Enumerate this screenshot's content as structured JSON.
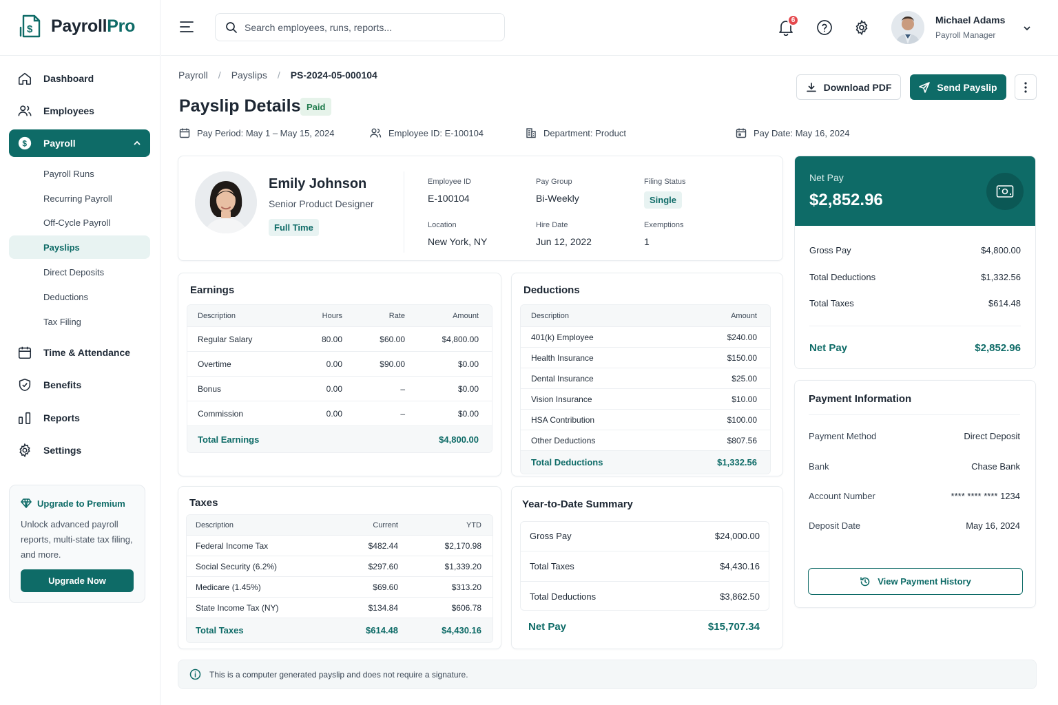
{
  "brand": {
    "name": "Payroll",
    "name_accent": "Pro"
  },
  "sidebar": {
    "nav": [
      {
        "label": "Dashboard",
        "icon": "home-icon"
      },
      {
        "label": "Employees",
        "icon": "users-icon"
      },
      {
        "label": "Payroll",
        "icon": "dollar-icon",
        "active": true
      },
      {
        "label": "Time & Attendance",
        "icon": "calendar-icon"
      },
      {
        "label": "Benefits",
        "icon": "shield-icon"
      },
      {
        "label": "Reports",
        "icon": "bar-chart-icon"
      },
      {
        "label": "Settings",
        "icon": "gear-icon"
      }
    ],
    "payroll_sub": [
      "Payroll Runs",
      "Recurring Payroll",
      "Off-Cycle Payroll",
      "Payslips",
      "Direct Deposits",
      "Deductions",
      "Tax Filing"
    ],
    "active_sub": "Payslips",
    "premium": {
      "title": "Upgrade to Premium",
      "text": "Unlock advanced payroll reports, multi-state tax filing, and more.",
      "button": "Upgrade Now"
    }
  },
  "topbar": {
    "search_placeholder": "Search employees, runs, reports...",
    "notification_count": "6",
    "user": {
      "name": "Michael Adams",
      "role": "Payroll Manager"
    }
  },
  "breadcrumb": [
    "Payroll",
    "Payslips",
    "PS-2024-05-000104"
  ],
  "page": {
    "title": "Payslip Details",
    "status": "Paid",
    "actions": {
      "download": "Download PDF",
      "send": "Send Payslip"
    },
    "meta": {
      "pay_period": "Pay Period: May 1 – May 15, 2024",
      "employee_id": "Employee ID: E-100104",
      "department": "Department: Product",
      "pay_date": "Pay Date: May 16, 2024"
    }
  },
  "employee": {
    "name": "Emily Johnson",
    "title": "Senior Product Designer",
    "type": "Full Time",
    "fields": {
      "employee_id_label": "Employee ID",
      "employee_id": "E-100104",
      "pay_group_label": "Pay Group",
      "pay_group": "Bi-Weekly",
      "filing_status_label": "Filing Status",
      "filing_status": "Single",
      "location_label": "Location",
      "location": "New York, NY",
      "hire_date_label": "Hire Date",
      "hire_date": "Jun 12, 2022",
      "exemptions_label": "Exemptions",
      "exemptions": "1"
    }
  },
  "earnings": {
    "title": "Earnings",
    "headers": [
      "Description",
      "Hours",
      "Rate",
      "Amount"
    ],
    "rows": [
      [
        "Regular Salary",
        "80.00",
        "$60.00",
        "$4,800.00"
      ],
      [
        "Overtime",
        "0.00",
        "$90.00",
        "$0.00"
      ],
      [
        "Bonus",
        "0.00",
        "–",
        "$0.00"
      ],
      [
        "Commission",
        "0.00",
        "–",
        "$0.00"
      ]
    ],
    "total_label": "Total Earnings",
    "total": "$4,800.00"
  },
  "deductions": {
    "title": "Deductions",
    "headers": [
      "Description",
      "Amount"
    ],
    "rows": [
      [
        "401(k) Employee",
        "$240.00"
      ],
      [
        "Health Insurance",
        "$150.00"
      ],
      [
        "Dental Insurance",
        "$25.00"
      ],
      [
        "Vision Insurance",
        "$10.00"
      ],
      [
        "HSA Contribution",
        "$100.00"
      ],
      [
        "Other Deductions",
        "$807.56"
      ]
    ],
    "total_label": "Total Deductions",
    "total": "$1,332.56"
  },
  "taxes": {
    "title": "Taxes",
    "headers": [
      "Description",
      "Current",
      "YTD"
    ],
    "rows": [
      [
        "Federal Income Tax",
        "$482.44",
        "$2,170.98"
      ],
      [
        "Social Security (6.2%)",
        "$297.60",
        "$1,339.20"
      ],
      [
        "Medicare (1.45%)",
        "$69.60",
        "$313.20"
      ],
      [
        "State Income Tax (NY)",
        "$134.84",
        "$606.78"
      ]
    ],
    "total_label": "Total Taxes",
    "total_current": "$614.48",
    "total_ytd": "$4,430.16"
  },
  "ytd": {
    "title": "Year-to-Date Summary",
    "rows": [
      [
        "Gross Pay",
        "$24,000.00"
      ],
      [
        "Total Taxes",
        "$4,430.16"
      ],
      [
        "Total Deductions",
        "$3,862.50"
      ]
    ],
    "net_label": "Net Pay",
    "net": "$15,707.34"
  },
  "net_pay": {
    "label": "Net Pay",
    "value": "$2,852.96",
    "rows": [
      [
        "Gross Pay",
        "$4,800.00"
      ],
      [
        "Total Deductions",
        "$1,332.56"
      ],
      [
        "Total Taxes",
        "$614.48"
      ]
    ],
    "total_label": "Net Pay",
    "total": "$2,852.96"
  },
  "payment_info": {
    "title": "Payment Information",
    "rows": [
      [
        "Payment Method",
        "Direct Deposit"
      ],
      [
        "Bank",
        "Chase Bank"
      ],
      [
        "Account Number",
        "**** **** **** 1234"
      ],
      [
        "Deposit Date",
        "May 16, 2024"
      ]
    ],
    "button": "View Payment History"
  },
  "notice": "This is a computer generated payslip and does not require a signature.",
  "colors": {
    "primary": "#0e6b67",
    "paid": "#1e7a4b",
    "badge_red": "#e5484d"
  }
}
